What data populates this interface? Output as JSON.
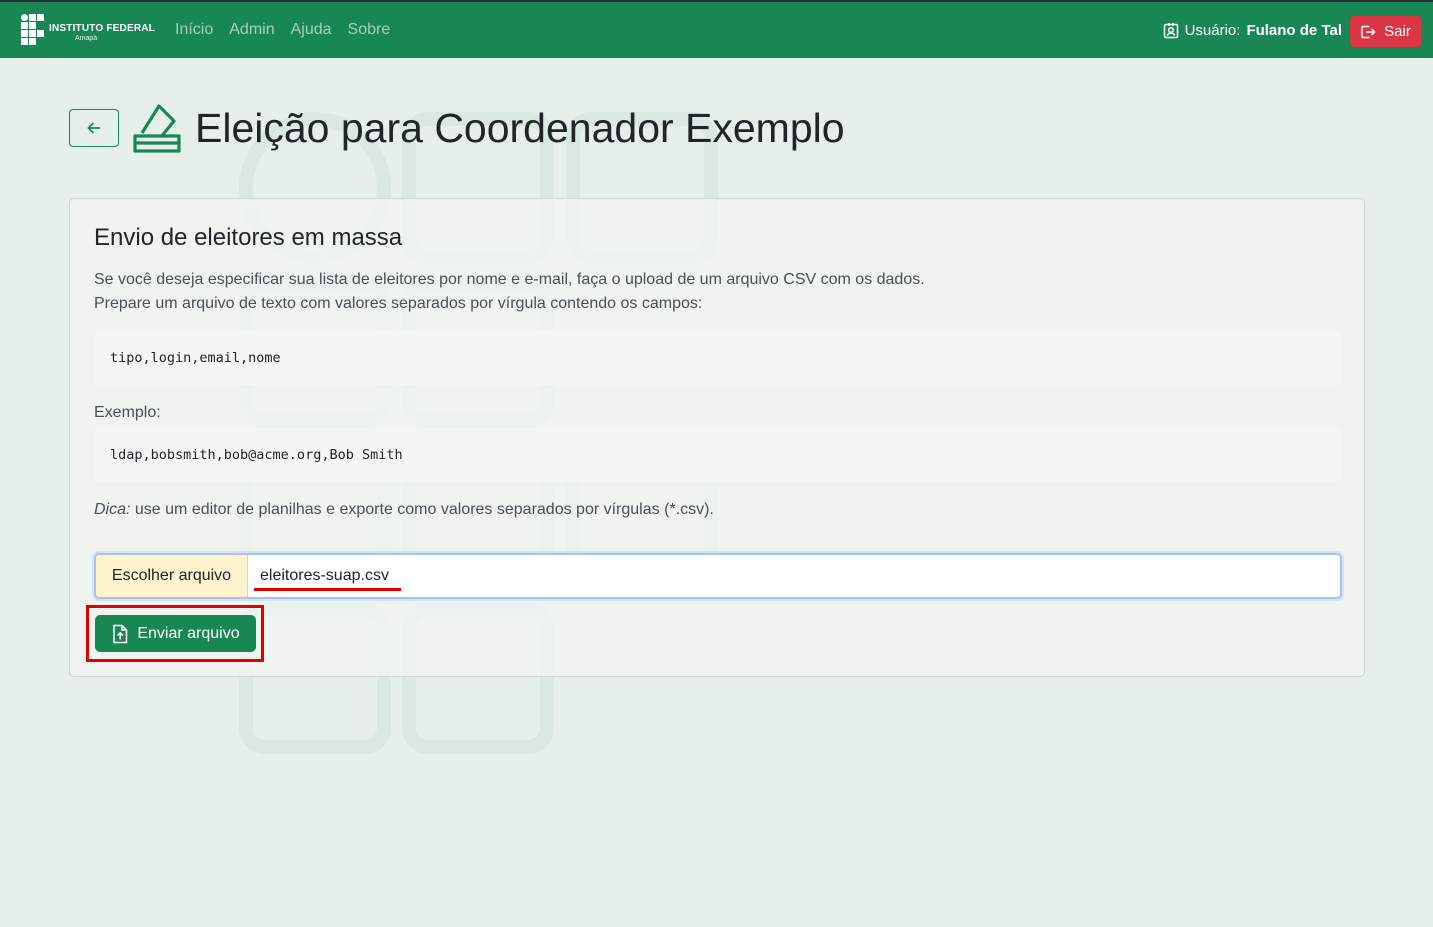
{
  "navbar": {
    "brand_name": "INSTITUTO FEDERAL",
    "brand_sub": "Amapá",
    "links": [
      {
        "label": "Início"
      },
      {
        "label": "Admin"
      },
      {
        "label": "Ajuda"
      },
      {
        "label": "Sobre"
      }
    ],
    "user_prefix": "Usuário:",
    "user_name": "Fulano de Tal",
    "logout_label": "Sair"
  },
  "header": {
    "title": "Eleição para Coordenador Exemplo"
  },
  "card": {
    "title": "Envio de eleitores em massa",
    "intro_line1": "Se você deseja especificar sua lista de eleitores por nome e e-mail, faça o upload de um arquivo CSV com os dados.",
    "intro_line2": "Prepare um arquivo de texto com valores separados por vírgula contendo os campos:",
    "fields_code": "tipo,login,email,nome",
    "example_label": "Exemplo:",
    "example_code": "ldap,bobsmith,bob@acme.org,Bob Smith",
    "tip_label": "Dica:",
    "tip_text": " use um editor de planilhas e exporte como valores separados por vírgulas (*.csv).",
    "file_button_label": "Escolher arquivo",
    "file_name": "eleitores-suap.csv",
    "submit_label": "Enviar arquivo"
  },
  "colors": {
    "primary": "#198754",
    "danger": "#dc3545",
    "highlight": "#e00000",
    "file_button_bg": "#fff3cd"
  }
}
